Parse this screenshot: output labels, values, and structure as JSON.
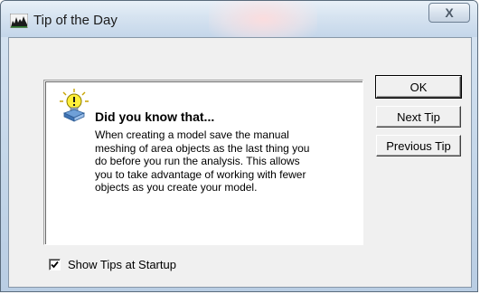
{
  "window": {
    "title": "Tip of the Day",
    "close_glyph": "X"
  },
  "tip": {
    "heading": "Did you know that...",
    "body": "When creating a model save the manual meshing of area objects as the last thing you do before you run the analysis. This allows you to take advantage of working with fewer objects as you create your model."
  },
  "buttons": {
    "ok": "OK",
    "next": "Next Tip",
    "previous": "Previous Tip"
  },
  "startup": {
    "label": "Show Tips at Startup",
    "checked": true
  },
  "icons": {
    "app": "app-chart-icon",
    "tip": "lightbulb-icon",
    "close": "close-icon",
    "check": "checkmark-icon"
  }
}
